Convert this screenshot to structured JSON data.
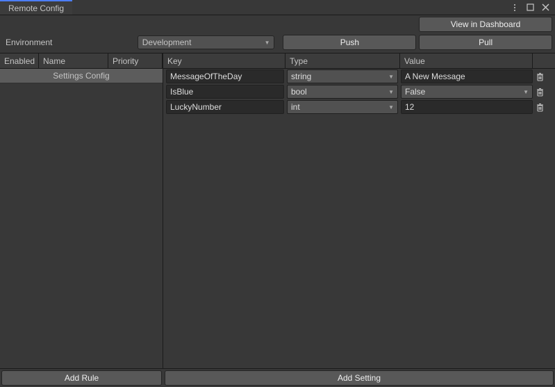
{
  "tab_title": "Remote Config",
  "top_buttons": {
    "view_dashboard": "View in Dashboard",
    "push": "Push",
    "pull": "Pull"
  },
  "environment": {
    "label": "Environment",
    "selected": "Development"
  },
  "left_panel": {
    "headers": {
      "enabled": "Enabled",
      "name": "Name",
      "priority": "Priority"
    },
    "rules": [
      {
        "label": "Settings Config"
      }
    ]
  },
  "right_panel": {
    "headers": {
      "key": "Key",
      "type": "Type",
      "value": "Value"
    },
    "settings": [
      {
        "key": "MessageOfTheDay",
        "type": "string",
        "value": "A New Message",
        "value_kind": "text"
      },
      {
        "key": "IsBlue",
        "type": "bool",
        "value": "False",
        "value_kind": "dropdown"
      },
      {
        "key": "LuckyNumber",
        "type": "int",
        "value": "12",
        "value_kind": "text"
      }
    ]
  },
  "footer": {
    "add_rule": "Add Rule",
    "add_setting": "Add Setting"
  }
}
